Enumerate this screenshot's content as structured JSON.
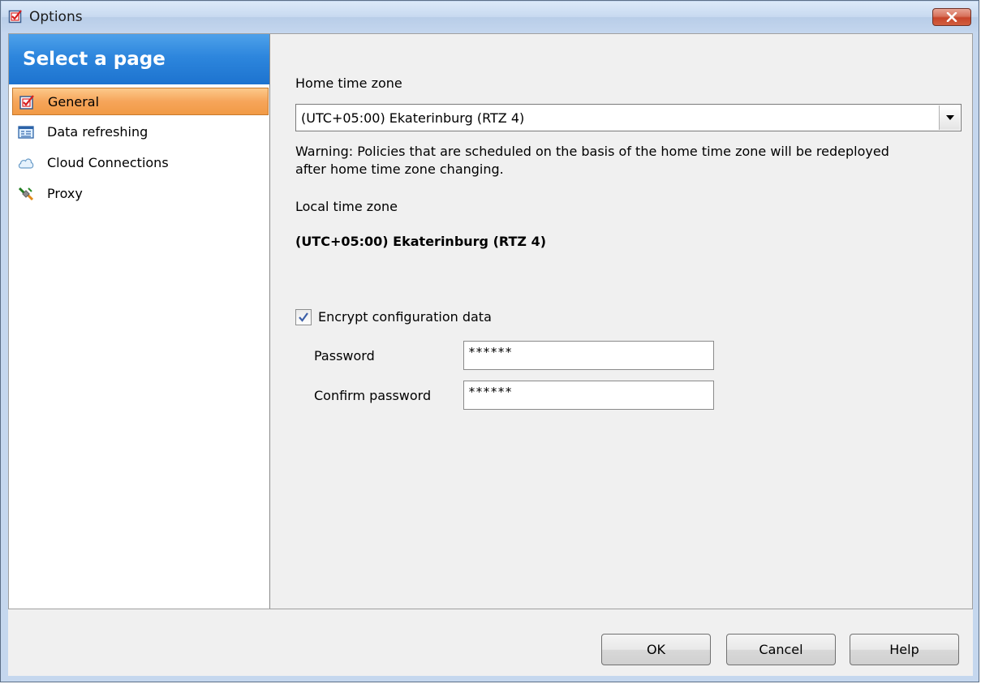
{
  "window": {
    "title": "Options",
    "title_icon": "checked-form-icon",
    "close_icon": "close-icon"
  },
  "sidebar": {
    "header": "Select a page",
    "items": [
      {
        "label": "General",
        "icon": "checked-form-icon",
        "selected": true
      },
      {
        "label": "Data refreshing",
        "icon": "data-table-icon",
        "selected": false
      },
      {
        "label": "Cloud Connections",
        "icon": "cloud-icon",
        "selected": false
      },
      {
        "label": "Proxy",
        "icon": "plug-icon",
        "selected": false
      }
    ]
  },
  "general": {
    "home_tz_label": "Home time zone",
    "home_tz_value": "(UTC+05:00) Ekaterinburg (RTZ 4)",
    "warning_line1": "Warning: Policies that are scheduled on the basis of the home time zone will be redeployed",
    "warning_line2": "after home time zone changing.",
    "local_tz_label": "Local time zone",
    "local_tz_value": "(UTC+05:00) Ekaterinburg (RTZ 4)",
    "encrypt_label": "Encrypt configuration data",
    "encrypt_checked": true,
    "password_label": "Password",
    "password_value": "******",
    "confirm_label": "Confirm password",
    "confirm_value": "******"
  },
  "buttons": {
    "ok": "OK",
    "cancel": "Cancel",
    "help": "Help"
  },
  "colors": {
    "sidebar_header": "#2d86dd",
    "selected_item": "#f6a55a",
    "close_button": "#c7452a"
  }
}
